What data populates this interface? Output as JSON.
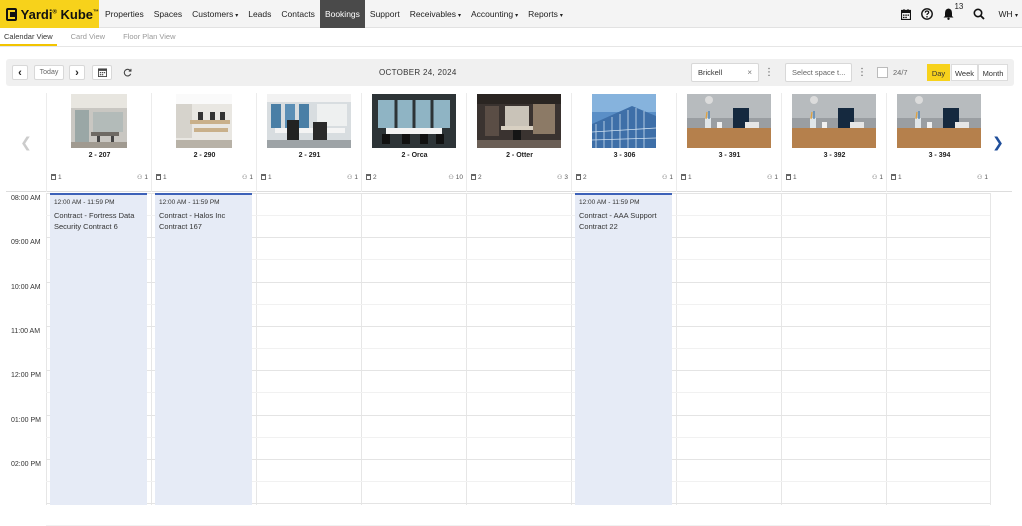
{
  "app": {
    "logo_text": "Yardi",
    "logo_text_2": "Kube",
    "logo_tm": "®",
    "logo_tm_2": "™",
    "brand_color": "#f7d21b",
    "accent_color": "#3d61b8"
  },
  "nav": {
    "items": [
      {
        "label": "Properties"
      },
      {
        "label": "Spaces"
      },
      {
        "label": "Customers",
        "caret": "▾"
      },
      {
        "label": "Leads"
      },
      {
        "label": "Contacts"
      },
      {
        "label": "Bookings",
        "active": true
      },
      {
        "label": "Support"
      },
      {
        "label": "Receivables",
        "caret": "▾"
      },
      {
        "label": "Accounting",
        "caret": "▾"
      },
      {
        "label": "Reports",
        "caret": "▾"
      }
    ],
    "right": {
      "calendar_icon": "calendar-icon",
      "help_icon": "help-icon",
      "notification_icon": "bell-icon",
      "notification_count": "13",
      "search_icon": "search-icon",
      "user_initials": "WH",
      "user_caret": "▾"
    }
  },
  "subtabs": [
    {
      "label": "Calendar View",
      "active": true
    },
    {
      "label": "Card View"
    },
    {
      "label": "Floor Plan View"
    }
  ],
  "toolbar": {
    "prev_glyph": "‹",
    "today_label": "Today",
    "next_glyph": "›",
    "date_label": "OCTOBER 24, 2024",
    "location_value": "Brickell",
    "clear_glyph": "×",
    "kebab_glyph": "⋮",
    "space_placeholder": "Select space t...",
    "all_day_label": "24/7",
    "views": [
      {
        "label": "Day",
        "active": true
      },
      {
        "label": "Week"
      },
      {
        "label": "Month"
      }
    ]
  },
  "resources": [
    {
      "name": "2 - 207",
      "desks": "1",
      "capacity": "1"
    },
    {
      "name": "2 - 290",
      "desks": "1",
      "capacity": "1"
    },
    {
      "name": "2 - 291",
      "desks": "1",
      "capacity": "1"
    },
    {
      "name": "2 - Orca",
      "desks": "2",
      "capacity": "10"
    },
    {
      "name": "2 - Otter",
      "desks": "2",
      "capacity": "3"
    },
    {
      "name": "3 - 306",
      "desks": "2",
      "capacity": "1"
    },
    {
      "name": "3 - 391",
      "desks": "1",
      "capacity": "1"
    },
    {
      "name": "3 - 392",
      "desks": "1",
      "capacity": "1"
    },
    {
      "name": "3 - 394",
      "desks": "1",
      "capacity": "1"
    }
  ],
  "times": [
    "08:00 AM",
    "09:00 AM",
    "10:00 AM",
    "11:00 AM",
    "12:00 PM",
    "01:00 PM",
    "02:00 PM"
  ],
  "bookings": [
    {
      "resource_index": 0,
      "time": "12:00 AM - 11:59 PM",
      "title": "Contract - Fortress Data Security Contract 6"
    },
    {
      "resource_index": 1,
      "time": "12:00 AM - 11:59 PM",
      "title": "Contract - Halos Inc Contract 167"
    },
    {
      "resource_index": 5,
      "time": "12:00 AM - 11:59 PM",
      "title": "Contract - AAA Support Contract 22"
    }
  ]
}
